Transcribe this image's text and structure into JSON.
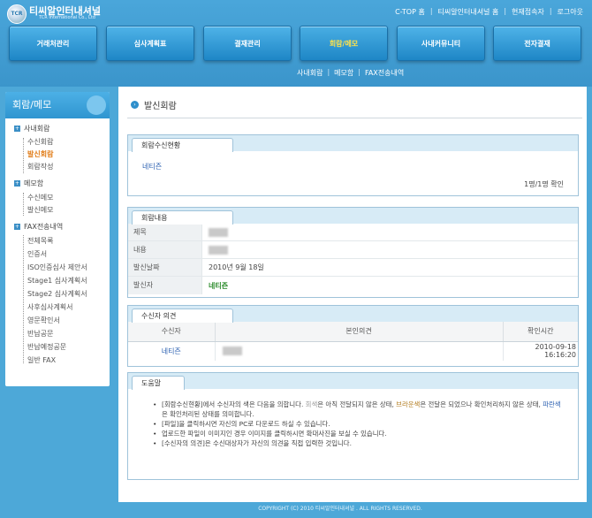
{
  "header": {
    "logo_badge": "TCR",
    "logo_title": "티씨알인터내셔널",
    "logo_sub": "TCR International Co., Ltd",
    "top_links": [
      "C-TOP 홈",
      "티씨알인터내셔널 홈",
      "현재접속자",
      "로그아웃"
    ],
    "top_sep": "|",
    "nav": [
      "거래처관리",
      "심사계획표",
      "결재관리",
      "회람/메모",
      "사내커뮤니티",
      "전자결재"
    ],
    "sub_nav": [
      "사내회람",
      "메모함",
      "FAX전송내역"
    ],
    "sub_sep": "|"
  },
  "sidebar": {
    "title": "회람/메모",
    "groups": [
      {
        "label": "사내회람",
        "items": [
          "수신회람",
          "발신회람",
          "회람작성"
        ]
      },
      {
        "label": "메모함",
        "items": [
          "수신메모",
          "발신메모"
        ]
      },
      {
        "label": "FAX전송내역",
        "items": [
          "전체목록",
          "인증서",
          "ISO인증심사 제안서",
          "Stage1 심사계획서",
          "Stage2 심사계획서",
          "사후심사계획서",
          "영문확인서",
          "반납공문",
          "반납예정공문",
          "일반 FAX"
        ]
      }
    ],
    "active_item": "발신회람"
  },
  "page": {
    "title": "발신회람",
    "status_panel": {
      "tab": "회람수신현황",
      "recipient": "네티즌",
      "count": "1명/1명 확인"
    },
    "content_panel": {
      "tab": "회람내용",
      "rows": [
        {
          "key": "제목",
          "value": ""
        },
        {
          "key": "내용",
          "value": ""
        },
        {
          "key": "발신날짜",
          "value": "2010년 9월 18일"
        },
        {
          "key": "발신자",
          "value": "네티즌"
        }
      ]
    },
    "opinion_panel": {
      "tab": "수신자 의견",
      "columns": [
        "수신자",
        "본인의견",
        "확인시간"
      ],
      "rows": [
        {
          "recipient": "네티즌",
          "opinion": "",
          "time": "2010-09-18 16:16:20"
        }
      ]
    },
    "help_panel": {
      "tab": "도움말",
      "items": [
        {
          "parts": [
            {
              "text": "[회람수신현황]에서 수신자의 색은 다음을 의합니다. ",
              "color": "#444444"
            },
            {
              "text": "회색",
              "color": "#9a9a9a"
            },
            {
              "text": "은 아직 전달되지 않은 상태, ",
              "color": "#444444"
            },
            {
              "text": "브라운색",
              "color": "#b07818"
            },
            {
              "text": "은 전달은 되었으나 확인처리하지 않은 상태, ",
              "color": "#444444"
            },
            {
              "text": "파란색",
              "color": "#2a5fb0"
            },
            {
              "text": "은 확인처리된 상태를 의미합니다.",
              "color": "#444444"
            }
          ]
        },
        {
          "parts": [
            {
              "text": "[파일]을 클릭하시면 자신의 PC로 다운로드 하실 수 있습니다.",
              "color": "#444444"
            }
          ]
        },
        {
          "parts": [
            {
              "text": "업로드한 파일이 이미지인 경우 이미지를 클릭하시면 확대사진을 보실 수 있습니다.",
              "color": "#444444"
            }
          ]
        },
        {
          "parts": [
            {
              "text": "[수신자의 의견]은 수신대상자가 자신의 의견을 직접 입력한 것입니다.",
              "color": "#444444"
            }
          ]
        }
      ]
    }
  },
  "footer": {
    "copyright": "COPYRIGHT (C) 2010 티씨알인터내셔널 . ALL RIGHTS RESERVED."
  },
  "colors": {
    "header_blue": "#3b95cb",
    "active_orange": "#e07a14",
    "link_blue": "#2a5fb0",
    "green_name": "#2a8a2a",
    "active_nav_text": "#ffe24a"
  }
}
